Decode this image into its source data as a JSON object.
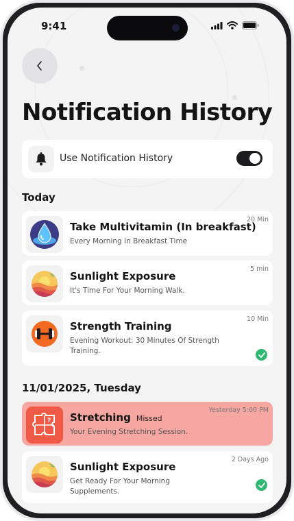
{
  "status_bar": {
    "time": "9:41"
  },
  "header": {
    "back_icon": "chevron-left-icon",
    "title": "Notification History"
  },
  "toggle": {
    "label": "Use Notification History",
    "enabled": true,
    "icon": "bell-icon"
  },
  "sections": [
    {
      "title": "Today",
      "items": [
        {
          "title": "Take Multivitamin (In breakfast)",
          "subtitle": "Every Morning In Breakfast Time",
          "time": "20 Min",
          "icon": "supplement-drop-icon",
          "completed": false
        },
        {
          "title": "Sunlight Exposure",
          "subtitle": "It's Time For Your Morning Walk.",
          "time": "5 min",
          "icon": "sunset-icon",
          "completed": false
        },
        {
          "title": "Strength Training",
          "subtitle": "Evening Workout: 30 Minutes Of Strength Training.",
          "time": "10 Min",
          "icon": "dumbbell-icon",
          "completed": true
        }
      ]
    },
    {
      "title": "11/01/2025, Tuesday",
      "items": [
        {
          "title": "Stretching",
          "status": "Missed",
          "subtitle": "Your Evening Stretching Session.",
          "time": "Yesterday 5:00 PM",
          "icon": "puzzle-question-icon",
          "completed": false
        },
        {
          "title": "Sunlight Exposure",
          "subtitle": "Get Ready For Your Morning Supplements.",
          "time": "2 Days Ago",
          "icon": "sunset-icon",
          "completed": true
        }
      ]
    }
  ],
  "colors": {
    "missed_bg": "#f7a7a1",
    "missed_icon_bg": "#ee5a45",
    "check_green": "#2eb872",
    "toggle_on": "#1c1c1e"
  }
}
